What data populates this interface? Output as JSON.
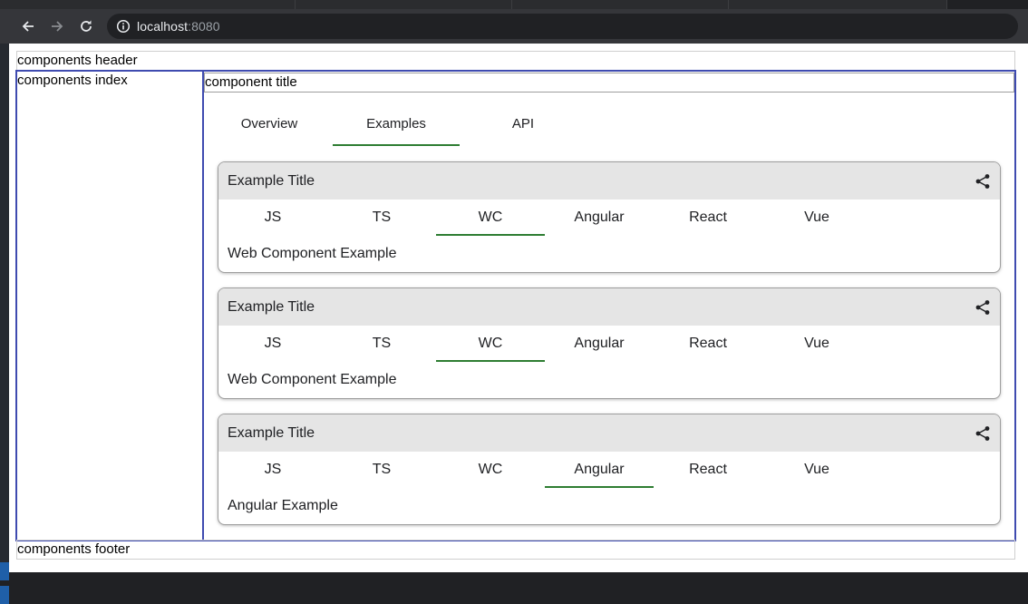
{
  "browser": {
    "url_host": "localhost",
    "url_port": ":8080",
    "icons": [
      "back-arrow-icon",
      "forward-arrow-icon",
      "reload-icon",
      "info-icon"
    ]
  },
  "page": {
    "header": "components header",
    "index": "components index",
    "component_title": "component title",
    "footer": "components footer",
    "tabs": [
      {
        "label": "Overview",
        "active": false
      },
      {
        "label": "Examples",
        "active": true
      },
      {
        "label": "API",
        "active": false
      }
    ],
    "cards": [
      {
        "title": "Example Title",
        "framework_tabs": [
          "JS",
          "TS",
          "WC",
          "Angular",
          "React",
          "Vue"
        ],
        "active_tab": "WC",
        "body": "Web Component Example"
      },
      {
        "title": "Example Title",
        "framework_tabs": [
          "JS",
          "TS",
          "WC",
          "Angular",
          "React",
          "Vue"
        ],
        "active_tab": "WC",
        "body": "Web Component Example"
      },
      {
        "title": "Example Title",
        "framework_tabs": [
          "JS",
          "TS",
          "WC",
          "Angular",
          "React",
          "Vue"
        ],
        "active_tab": "Angular",
        "body": "Angular Example"
      }
    ]
  },
  "colors": {
    "accent": "#2e7d32",
    "layout_border": "#3f4bb0",
    "card_header_bg": "#e5e5e5"
  }
}
